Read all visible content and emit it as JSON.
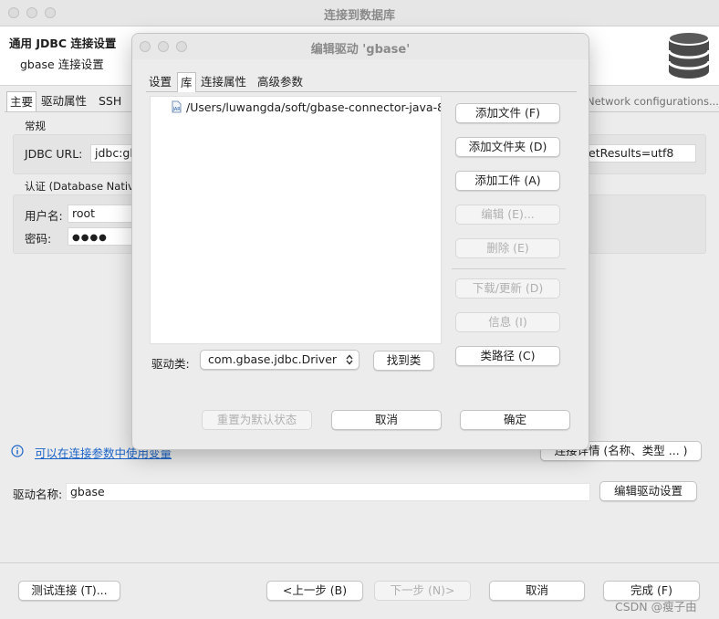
{
  "main_window": {
    "title": "连接到数据库",
    "header_title": "通用 JDBC 连接设置",
    "header_subtitle": "gbase 连接设置",
    "tabs": [
      "主要",
      "驱动属性",
      "SSH"
    ],
    "network_link": "Network configurations...",
    "section_general": "常规",
    "jdbc_url_label": "JDBC URL:",
    "jdbc_url_value_start": "jdbc:gb",
    "jdbc_url_value_end": "etResults=utf8",
    "section_auth": "认证 (Database Native)",
    "username_label": "用户名:",
    "username_value": "root",
    "password_label": "密码:",
    "password_value": "●●●●",
    "info_link": "可以在连接参数中使用变量",
    "connection_details_button": "连接详情 (名称、类型 ... )",
    "driver_name_label": "驱动名称:",
    "driver_name_value": "gbase",
    "edit_driver_button": "编辑驱动设置",
    "test_button": "测试连接 (T)...",
    "back_button": "<上一步 (B)",
    "next_button": "下一步 (N)>",
    "cancel_button": "取消",
    "finish_button": "完成 (F)",
    "watermark": "CSDN @瘦子由"
  },
  "dialog": {
    "title": "编辑驱动 'gbase'",
    "tabs": [
      "设置",
      "库",
      "连接属性",
      "高级参数"
    ],
    "active_tab": "库",
    "library_items": [
      "/Users/luwangda/soft/gbase-connector-java-8"
    ],
    "side_buttons": [
      {
        "label": "添加文件 (F)",
        "enabled": true
      },
      {
        "label": "添加文件夹 (D)",
        "enabled": true
      },
      {
        "label": "添加工件 (A)",
        "enabled": true
      },
      {
        "label": "编辑 (E)...",
        "enabled": false
      },
      {
        "label": "删除 (E)",
        "enabled": false
      },
      {
        "label": "下载/更新 (D)",
        "enabled": false
      },
      {
        "label": "信息 (I)",
        "enabled": false
      },
      {
        "label": "类路径 (C)",
        "enabled": true
      }
    ],
    "driver_class_label": "驱动类:",
    "driver_class_value": "com.gbase.jdbc.Driver",
    "find_class_button": "找到类",
    "reset_button": "重置为默认状态",
    "cancel_button": "取消",
    "ok_button": "确定"
  },
  "icons": {
    "database": "database-icon",
    "jar_file": "jar-file-icon",
    "info": "info-icon",
    "select_arrows": "select-updown-icon"
  },
  "colors": {
    "link": "#1a63c7",
    "window_bg": "#ececec",
    "dialog_bg": "#ececec"
  }
}
